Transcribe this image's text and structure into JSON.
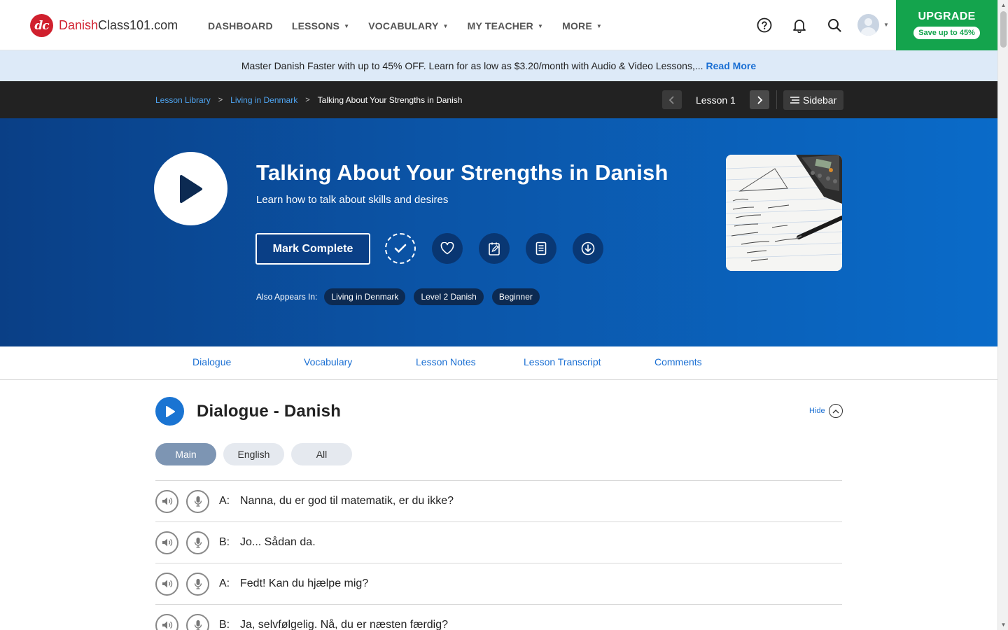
{
  "header": {
    "logo_mark": "dc",
    "logo_brand": "Danish",
    "logo_rest": "Class101.com",
    "nav": [
      {
        "label": "DASHBOARD",
        "dropdown": false
      },
      {
        "label": "LESSONS",
        "dropdown": true
      },
      {
        "label": "VOCABULARY",
        "dropdown": true
      },
      {
        "label": "MY TEACHER",
        "dropdown": true
      },
      {
        "label": "MORE",
        "dropdown": true
      }
    ],
    "icons": [
      "help-icon",
      "bell-icon",
      "search-icon",
      "avatar"
    ],
    "upgrade_title": "UPGRADE",
    "upgrade_badge": "Save up to 45%"
  },
  "promo": {
    "text": "Master Danish Faster with up to 45% OFF. Learn for as low as $3.20/month with Audio & Video Lessons,...",
    "link": "Read More"
  },
  "breadcrumb": {
    "items": [
      "Lesson Library",
      "Living in Denmark"
    ],
    "current": "Talking About Your Strengths in Danish",
    "lesson_label": "Lesson 1",
    "sidebar_label": "Sidebar"
  },
  "hero": {
    "title": "Talking About Your Strengths in Danish",
    "subtitle": "Learn how to talk about skills and desires",
    "mark_complete": "Mark Complete",
    "also_label": "Also Appears In:",
    "tags": [
      "Living in Denmark",
      "Level 2 Danish",
      "Beginner"
    ],
    "action_icons": [
      "checkmark-icon",
      "heart-icon",
      "notes-icon",
      "pdf-icon",
      "download-icon"
    ]
  },
  "tabs": [
    "Dialogue",
    "Vocabulary",
    "Lesson Notes",
    "Lesson Transcript",
    "Comments"
  ],
  "dialogue": {
    "title": "Dialogue - Danish",
    "hide_label": "Hide",
    "toggles": [
      {
        "label": "Main",
        "active": true
      },
      {
        "label": "English",
        "active": false
      },
      {
        "label": "All",
        "active": false
      }
    ],
    "lines": [
      {
        "speaker": "A:",
        "text": "Nanna, du er god til matematik, er du ikke?"
      },
      {
        "speaker": "B:",
        "text": "Jo... Sådan da."
      },
      {
        "speaker": "A:",
        "text": "Fedt! Kan du hjælpe mig?"
      },
      {
        "speaker": "B:",
        "text": "Ja, selvfølgelig. Nå, du er næsten færdig?"
      }
    ]
  },
  "colors": {
    "brand_red": "#d0202e",
    "upgrade_green": "#14a44d",
    "link_blue": "#1a6fd3",
    "hero_dark": "#0a3f86",
    "hero_light": "#0a6bc9"
  }
}
